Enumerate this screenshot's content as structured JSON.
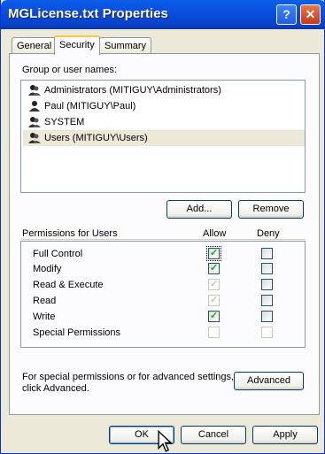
{
  "window": {
    "title": "MGLicense.txt Properties"
  },
  "titlebar": {
    "help_label": "?",
    "close_label": "✕"
  },
  "tabs": [
    {
      "label": "General",
      "active": false
    },
    {
      "label": "Security",
      "active": true
    },
    {
      "label": "Summary",
      "active": false
    }
  ],
  "group_label": "Group or user names:",
  "users": [
    {
      "label": "Administrators (MITIGUY\\Administrators)",
      "icon": "group-icon",
      "selected": false
    },
    {
      "label": "Paul (MITIGUY\\Paul)",
      "icon": "user-icon",
      "selected": false
    },
    {
      "label": "SYSTEM",
      "icon": "group-icon",
      "selected": false
    },
    {
      "label": "Users (MITIGUY\\Users)",
      "icon": "group-icon",
      "selected": true
    }
  ],
  "buttons": {
    "add": "Add...",
    "remove": "Remove",
    "advanced": "Advanced",
    "ok": "OK",
    "cancel": "Cancel",
    "apply": "Apply"
  },
  "permissions": {
    "title": "Permissions for Users",
    "allow_label": "Allow",
    "deny_label": "Deny",
    "rows": [
      {
        "label": "Full Control",
        "allow": "checked",
        "deny": "unchecked",
        "allow_focused": true
      },
      {
        "label": "Modify",
        "allow": "checked",
        "deny": "unchecked"
      },
      {
        "label": "Read & Execute",
        "allow": "checked-disabled",
        "deny": "unchecked"
      },
      {
        "label": "Read",
        "allow": "checked-disabled",
        "deny": "unchecked"
      },
      {
        "label": "Write",
        "allow": "checked",
        "deny": "unchecked"
      },
      {
        "label": "Special Permissions",
        "allow": "disabled",
        "deny": "disabled"
      }
    ]
  },
  "advanced_text_line1": "For special permissions or for advanced settings,",
  "advanced_text_line2": "click Advanced.",
  "colors": {
    "titlebar": "#0a4ee0",
    "dialog_bg": "#ece9d8",
    "panel_bg": "#fcfcfe",
    "check_green": "#21a121"
  }
}
